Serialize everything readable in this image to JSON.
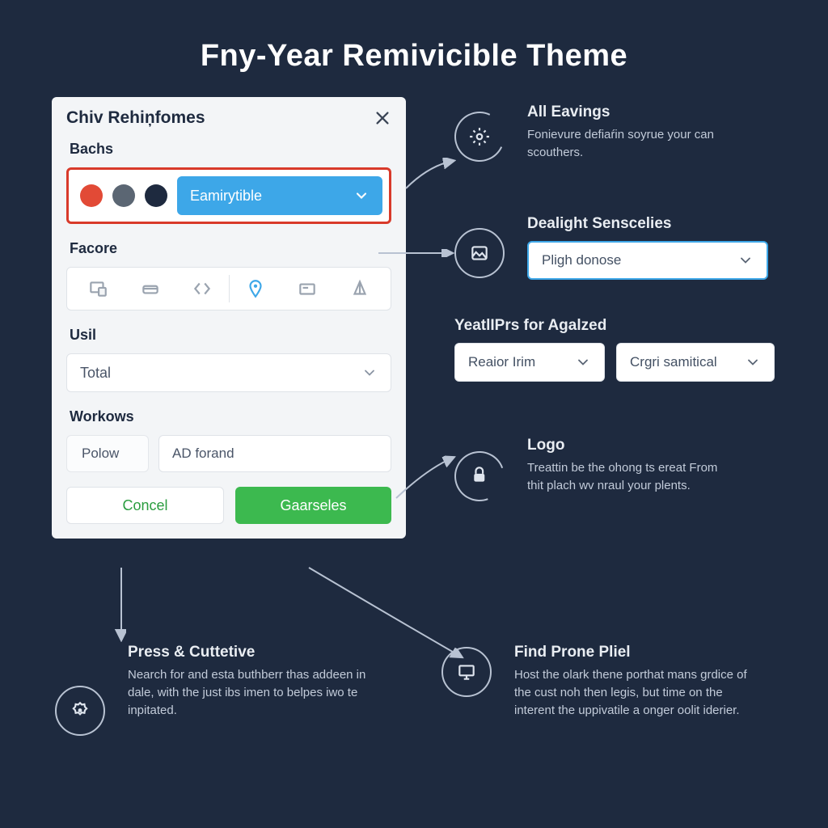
{
  "title": "Fny-Year Remivicible Theme",
  "panel": {
    "title": "Chiv Rehiņfomes",
    "bachs_label": "Bachs",
    "bachs_select": "Eamirytible",
    "facore_label": "Facore",
    "usil_label": "Usil",
    "usil_value": "Total",
    "workows_label": "Workows",
    "workows_prefix": "Polow",
    "workows_value": "AD forand",
    "cancel": "Concel",
    "primary": "Gaarseles"
  },
  "right": {
    "all": {
      "title": "All Eavings",
      "body": "Fonievure defiaŕin soyrue your can scouthers."
    },
    "dealight": {
      "title": "Dealight Senscelies",
      "select": "Pligh donose"
    },
    "yeat": {
      "title": "YeatlIPrs for Agalzed",
      "select1": "Reaior Irim",
      "select2": "Crgri samitical"
    },
    "logo": {
      "title": "Logo",
      "body": "Treattin be the ohong ts ereat From thit plach wv nraul your plents."
    }
  },
  "bottom": {
    "left": {
      "title": "Press & Cuttetive",
      "body": "Nearch for and esta buthberr thas addeen in dale, with the just ibs imen to belpes iwo te inpitated."
    },
    "right": {
      "title": "Find Prone Pliel",
      "body": "Host the olark thene porthat mans grdice of the cust noh then legis, but time on the interent the uppivatile a onger oolit iderier."
    }
  },
  "colors": {
    "sw1": "#e24a36",
    "sw2": "#5b6673",
    "sw3": "#1e2a3f"
  }
}
